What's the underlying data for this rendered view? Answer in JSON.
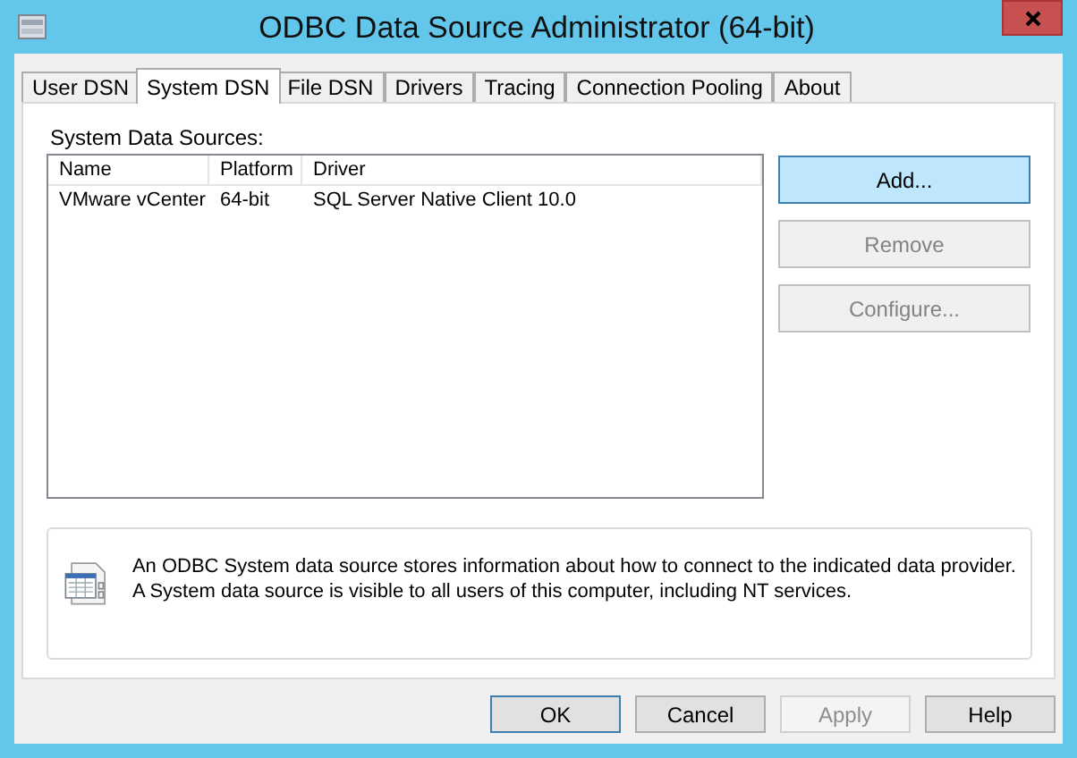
{
  "window": {
    "title": "ODBC Data Source Administrator (64-bit)"
  },
  "tabs": [
    {
      "label": "User DSN",
      "selected": false
    },
    {
      "label": "System DSN",
      "selected": true
    },
    {
      "label": "File DSN",
      "selected": false
    },
    {
      "label": "Drivers",
      "selected": false
    },
    {
      "label": "Tracing",
      "selected": false
    },
    {
      "label": "Connection Pooling",
      "selected": false
    },
    {
      "label": "About",
      "selected": false
    }
  ],
  "list_label": "System Data Sources:",
  "table": {
    "columns": [
      "Name",
      "Platform",
      "Driver"
    ],
    "rows": [
      {
        "cells": [
          "VMware vCenter",
          "64-bit",
          "SQL Server Native Client 10.0"
        ],
        "selected": false
      }
    ]
  },
  "side_buttons": [
    {
      "label": "Add...",
      "disabled": false,
      "hot": true
    },
    {
      "label": "Remove",
      "disabled": true,
      "hot": false
    },
    {
      "label": "Configure...",
      "disabled": true,
      "hot": false
    }
  ],
  "info": {
    "lines": [
      "An ODBC System data source stores information about how to connect to the indicated data provider.",
      "A System data source is visible to all users of this computer, including NT services."
    ]
  },
  "buttons": [
    {
      "label": "OK",
      "disabled": false,
      "default": true
    },
    {
      "label": "Cancel",
      "disabled": false,
      "default": false
    },
    {
      "label": "Apply",
      "disabled": true,
      "default": false
    },
    {
      "label": "Help",
      "disabled": false,
      "default": false
    }
  ]
}
